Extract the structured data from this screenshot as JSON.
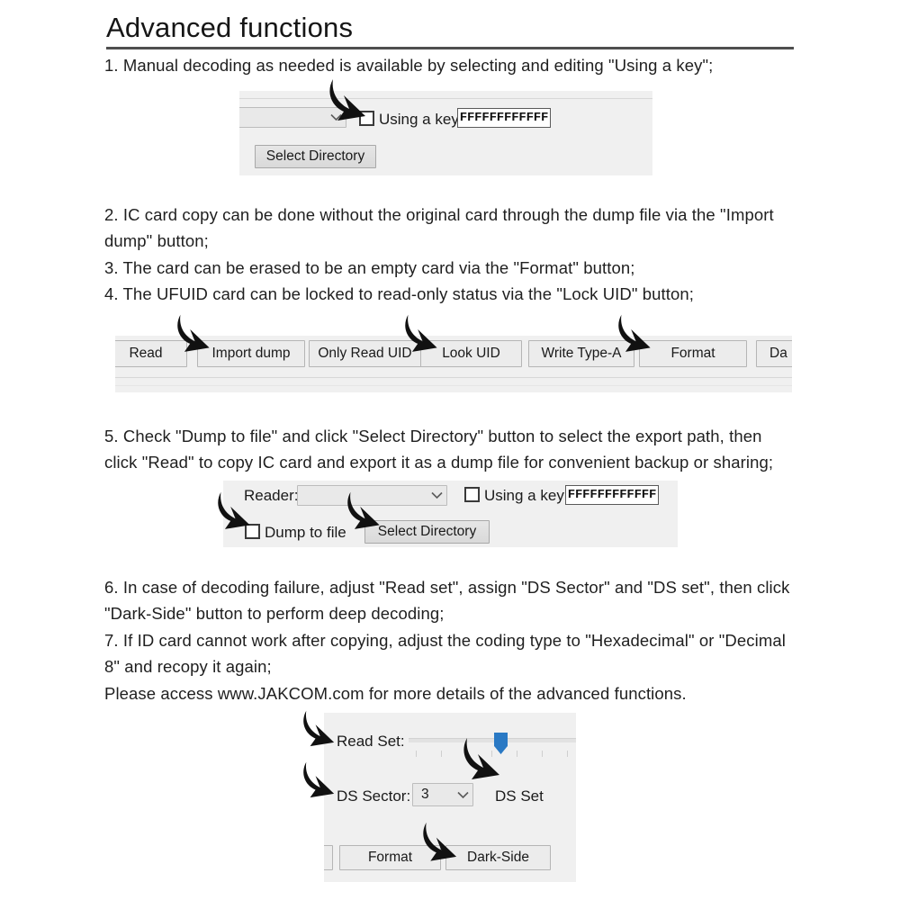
{
  "header": {
    "title": "Advanced functions"
  },
  "instructions": [
    "1. Manual decoding as needed is available by selecting and editing \"Using a key\";",
    "2. IC card copy can be done without the original card through the dump file via the \"Import dump\" button;",
    "3. The card can be erased to be an empty card via the \"Format\" button;",
    "4. The UFUID card can be locked to read-only status via the \"Lock UID\" button;",
    "5. Check \"Dump to file\" and click \"Select Directory\" button to select the export path, then click \"Read\" to copy IC card and export it as a dump file for convenient backup or sharing;",
    "6. In case of decoding failure, adjust \"Read set\", assign \"DS Sector\" and \"DS set\", then click \"Dark-Side\" button to perform deep decoding;",
    "7. If ID card cannot work after copying, adjust the coding type to \"Hexadecimal\" or \"Decimal 8\" and recopy it again;",
    "Please access www.JAKCOM.com for more details of the advanced functions."
  ],
  "panel_key": {
    "combo_value": "",
    "checkbox_label": "Using a key",
    "checkbox_checked": false,
    "key_value": "FFFFFFFFFFFF",
    "select_directory_label": "Select Directory"
  },
  "panel_buttons": {
    "buttons": [
      {
        "label": "Read"
      },
      {
        "label": "Import dump"
      },
      {
        "label": "Only Read UID"
      },
      {
        "label": "Look UID"
      },
      {
        "label": "Write Type-A"
      },
      {
        "label": "Format"
      },
      {
        "label": "Da"
      }
    ]
  },
  "panel_reader": {
    "reader_label": "Reader:",
    "reader_value": "",
    "dump_to_file_label": "Dump to file",
    "dump_to_file_checked": false,
    "checkbox_label": "Using a key",
    "checkbox_checked": false,
    "key_value": "FFFFFFFFFFFF",
    "select_directory_label": "Select Directory"
  },
  "panel_darkside": {
    "read_set_label": "Read Set:",
    "read_set_value": 60,
    "ds_sector_label": "DS Sector:",
    "ds_sector_value": "3",
    "ds_set_label": "DS Set",
    "format_label": "Format",
    "dark_side_label": "Dark-Side"
  },
  "colors": {
    "slider_accent": "#2a79c4",
    "panel_bg": "#f0f0f0",
    "rule": "#4f4f4f"
  },
  "icons": {
    "chevron_down": "chevron-down-icon",
    "annotation_arrow": "curved-arrow-icon"
  }
}
